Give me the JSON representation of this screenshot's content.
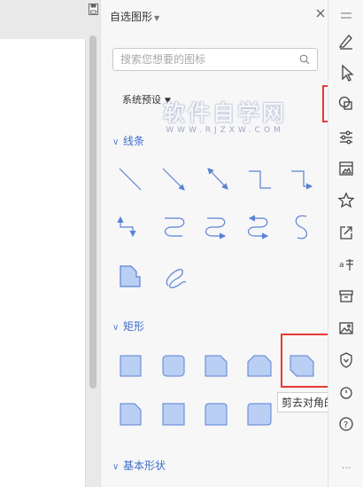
{
  "panel": {
    "title": "自选图形",
    "search_placeholder": "搜索您想要的图标",
    "preset_label": "系统预设",
    "sections": {
      "lines": "线条",
      "rect": "矩形",
      "basic": "基本形状"
    }
  },
  "watermark": {
    "main": "软件自学网",
    "sub": "WWW.RJZXW.COM"
  },
  "tooltip": "剪去对角的矩形",
  "rail": {
    "items": [
      "menu-icon",
      "pen-icon",
      "cursor-icon",
      "shapes-icon",
      "settings-icon",
      "image-panel-icon",
      "star-icon",
      "share-icon",
      "translate-icon",
      "archive-icon",
      "picture-icon",
      "shield-icon",
      "history-icon",
      "help-icon",
      "more-icon"
    ],
    "more_label": "···"
  },
  "colors": {
    "shape_fill": "#b9cff3",
    "shape_stroke": "#5a82d4",
    "section_blue": "#3f6fc9",
    "highlight_red": "#e53935"
  }
}
